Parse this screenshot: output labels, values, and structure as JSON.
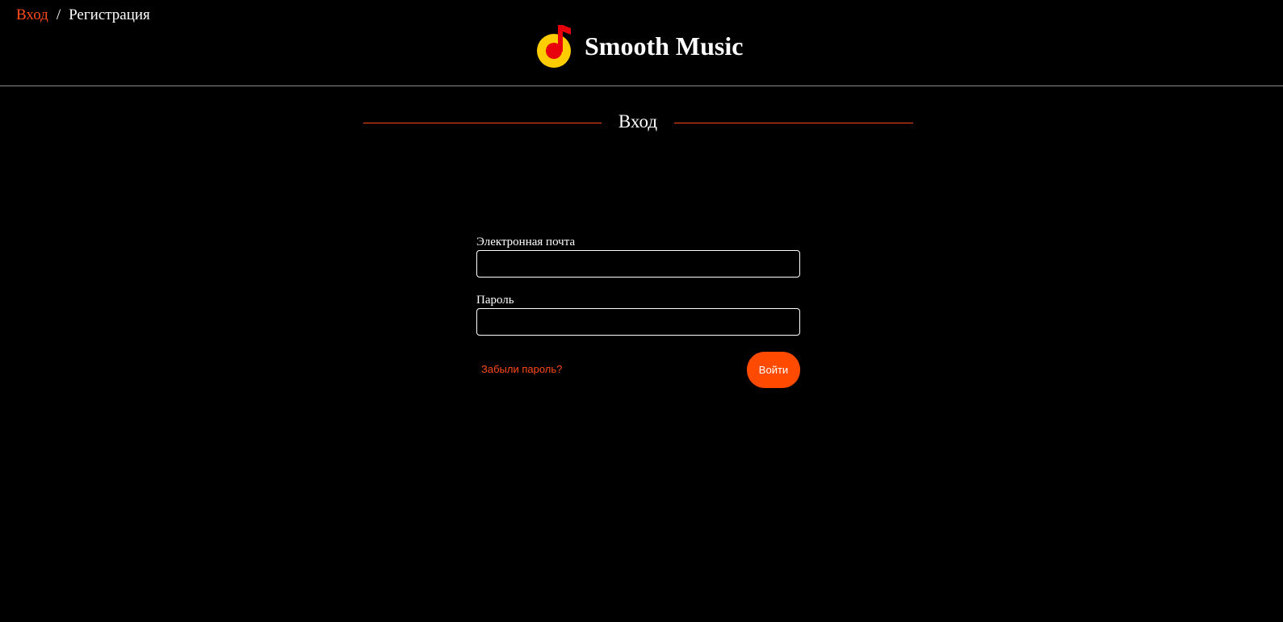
{
  "auth_nav": {
    "login_label": "Вход",
    "separator": "/",
    "register_label": "Регистрация"
  },
  "brand": {
    "name": "Smooth Music",
    "logo_icon": "music-note-icon",
    "colors": {
      "logo_ring": "#ffcc00",
      "logo_note": "#e8000b"
    }
  },
  "section": {
    "title": "Вход"
  },
  "login_form": {
    "email_label": "Электронная почта",
    "email_value": "",
    "password_label": "Пароль",
    "password_value": "",
    "forgot_password_label": "Забыли пароль?",
    "submit_label": "Войти"
  },
  "theme": {
    "background": "#000000",
    "accent": "#ff4a1c",
    "button": "#ff4a00",
    "text": "#ffffff",
    "divider": "#8a8a8a"
  }
}
